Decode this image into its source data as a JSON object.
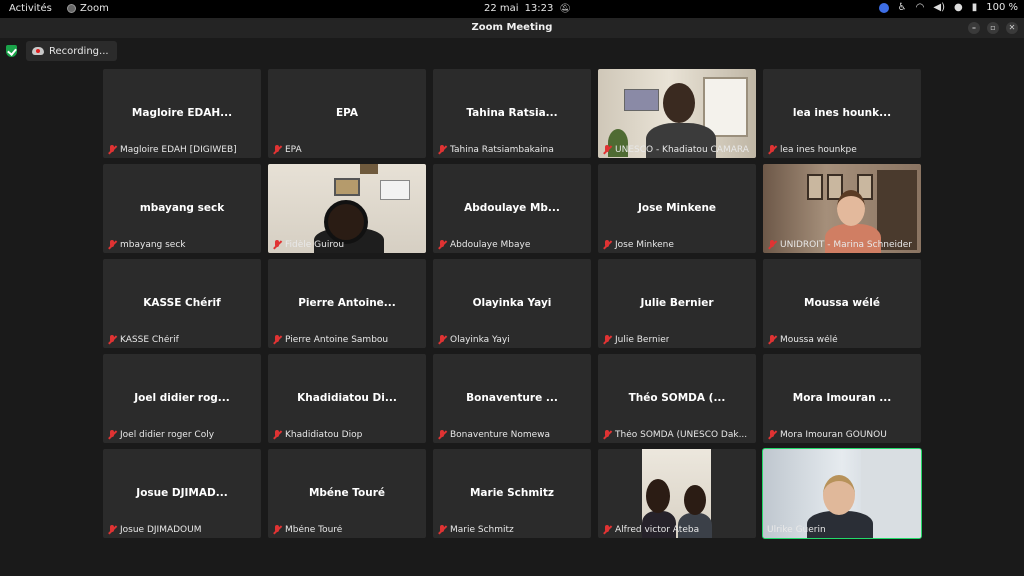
{
  "topbar": {
    "activities": "Activités",
    "app_name": "Zoom",
    "date": "22 mai",
    "time": "13:23",
    "battery": "100 %"
  },
  "window": {
    "title": "Zoom Meeting"
  },
  "recording": {
    "label": "Recording..."
  },
  "colors": {
    "active_speaker_border": "#23d96a",
    "muted_icon": "#e03333",
    "tile_bg": "#2b2b2b",
    "security_shield": "#1aa34a"
  },
  "participants": [
    {
      "display": "Magloire EDAH...",
      "caption": "Magloire EDAH [DIGIWEB]",
      "muted": true
    },
    {
      "display": "EPA",
      "caption": "EPA",
      "muted": true
    },
    {
      "display": "Tahina Ratsia...",
      "caption": "Tahina Ratsiambakaina",
      "muted": true
    },
    {
      "display": "",
      "caption": "UNESCO - Khadiatou CAMARA",
      "muted": true,
      "video": "unesco"
    },
    {
      "display": "lea ines hounk...",
      "caption": "lea ines hounkpe",
      "muted": true
    },
    {
      "display": "mbayang seck",
      "caption": "mbayang seck",
      "muted": true
    },
    {
      "display": "",
      "caption": "Fidèle Guirou",
      "muted": true,
      "video": "fidele"
    },
    {
      "display": "Abdoulaye Mb...",
      "caption": "Abdoulaye Mbaye",
      "muted": true
    },
    {
      "display": "Jose Minkene",
      "caption": "Jose Minkene",
      "muted": true
    },
    {
      "display": "",
      "caption": "UNIDROIT - Marina Schneider",
      "muted": true,
      "video": "unidroit"
    },
    {
      "display": "KASSE Chérif",
      "caption": "KASSE Chérif",
      "muted": true
    },
    {
      "display": "Pierre Antoine...",
      "caption": "Pierre Antoine Sambou",
      "muted": true
    },
    {
      "display": "Olayinka Yayi",
      "caption": "Olayinka Yayi",
      "muted": true
    },
    {
      "display": "Julie Bernier",
      "caption": "Julie Bernier",
      "muted": true
    },
    {
      "display": "Moussa wélé",
      "caption": "Moussa wélé",
      "muted": true
    },
    {
      "display": "Joel didier rog...",
      "caption": "Joel didier roger Coly",
      "muted": true
    },
    {
      "display": "Khadidiatou Di...",
      "caption": "Khadidiatou Diop",
      "muted": true
    },
    {
      "display": "Bonaventure ...",
      "caption": "Bonaventure Nomewa",
      "muted": true
    },
    {
      "display": "Théo SOMDA (...",
      "caption": "Théo SOMDA (UNESCO Dak...",
      "muted": true
    },
    {
      "display": "Mora Imouran ...",
      "caption": "Mora Imouran GOUNOU",
      "muted": true
    },
    {
      "display": "Josue DJIMAD...",
      "caption": "Josue DJIMADOUM",
      "muted": true
    },
    {
      "display": "Mbéne Touré",
      "caption": "Mbéne Touré",
      "muted": true
    },
    {
      "display": "Marie Schmitz",
      "caption": "Marie Schmitz",
      "muted": true
    },
    {
      "display": "",
      "caption": "Alfred victor Ateba",
      "muted": true,
      "video": "alfred"
    },
    {
      "display": "",
      "caption": "Ulrike Guerin",
      "muted": false,
      "video": "ulrike",
      "active": true
    }
  ]
}
